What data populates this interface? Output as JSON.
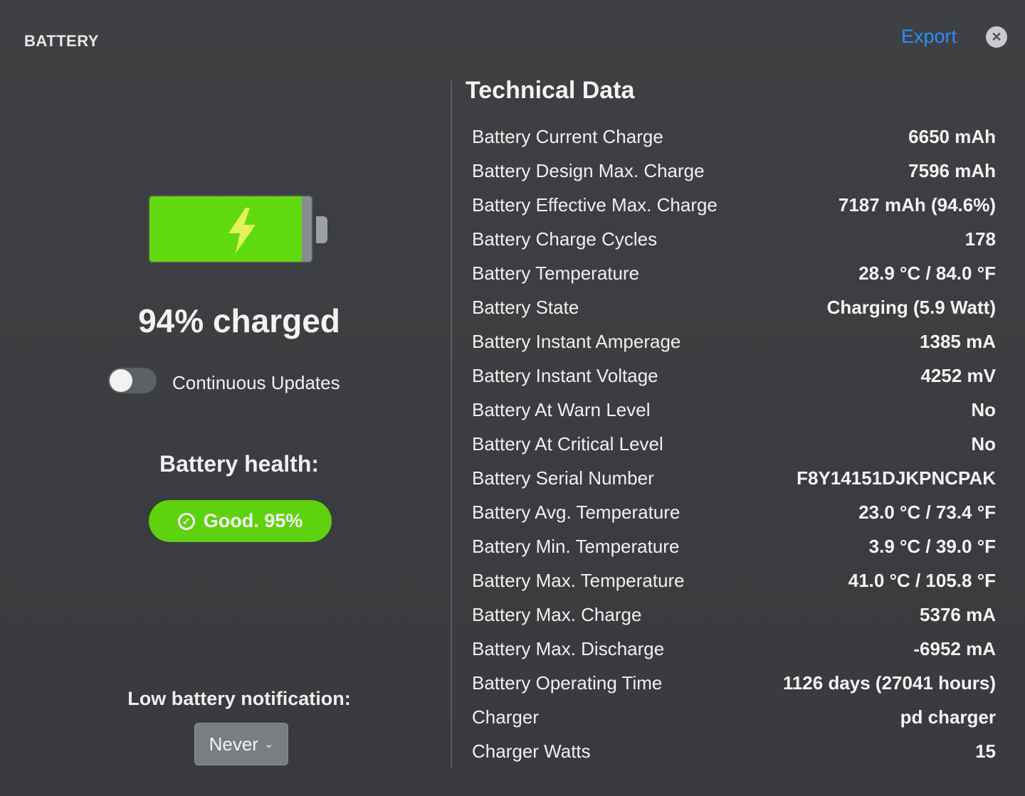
{
  "window": {
    "title": "BATTERY",
    "export_label": "Export",
    "close_icon": "close-icon"
  },
  "status": {
    "charged_text": "94% charged",
    "charge_level": 0.94,
    "battery_color": "#61d90f",
    "continuous_updates_label": "Continuous Updates",
    "continuous_updates_on": false
  },
  "health": {
    "label": "Battery health:",
    "value": "Good. 95%",
    "color": "#5fd20f"
  },
  "notification": {
    "label": "Low battery notification:",
    "selected": "Never"
  },
  "technical": {
    "title": "Technical Data",
    "rows": [
      {
        "label": "Battery Current Charge",
        "value": "6650 mAh"
      },
      {
        "label": "Battery Design Max. Charge",
        "value": "7596 mAh"
      },
      {
        "label": "Battery Effective Max. Charge",
        "value": "7187 mAh (94.6%)"
      },
      {
        "label": "Battery Charge Cycles",
        "value": "178"
      },
      {
        "label": "Battery Temperature",
        "value": "28.9 °C / 84.0 °F"
      },
      {
        "label": "Battery State",
        "value": "Charging (5.9 Watt)"
      },
      {
        "label": "Battery Instant Amperage",
        "value": "1385 mA"
      },
      {
        "label": "Battery Instant Voltage",
        "value": "4252 mV"
      },
      {
        "label": "Battery At Warn Level",
        "value": "No"
      },
      {
        "label": "Battery At Critical Level",
        "value": "No"
      },
      {
        "label": "Battery Serial Number",
        "value": "F8Y14151DJKPNCPAK"
      },
      {
        "label": "Battery Avg. Temperature",
        "value": "23.0 °C / 73.4 °F"
      },
      {
        "label": "Battery Min. Temperature",
        "value": "3.9 °C / 39.0 °F"
      },
      {
        "label": "Battery Max. Temperature",
        "value": "41.0 °C / 105.8 °F"
      },
      {
        "label": "Battery Max. Charge",
        "value": "5376 mA"
      },
      {
        "label": "Battery Max. Discharge",
        "value": "-6952 mA"
      },
      {
        "label": "Battery Operating Time",
        "value": "1126 days (27041 hours)"
      },
      {
        "label": "Charger",
        "value": "pd charger"
      },
      {
        "label": "Charger Watts",
        "value": "15"
      }
    ]
  }
}
